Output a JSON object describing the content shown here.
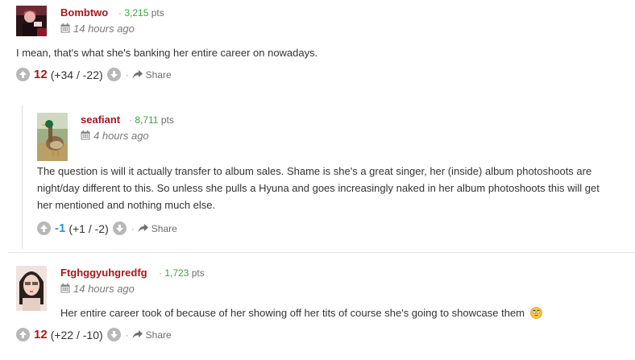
{
  "comments": [
    {
      "username": "Bombtwo",
      "points": "3,215",
      "points_suffix": "pts",
      "time": "14 hours ago",
      "text": "I mean, that's what she's banking her entire career on nowadays.",
      "score": "12",
      "breakdown": "(+34 / -22)",
      "share": "Share"
    },
    {
      "username": "seafiant",
      "points": "8,711",
      "points_suffix": "pts",
      "time": "4 hours ago",
      "text": "The question is will it actually transfer to album sales. Shame is she's a great singer, her (inside) album photoshoots are night/day different to this. So unless she pulls a Hyuna and goes increasingly naked in her album photoshoots this will get her mentioned and nothing much else.",
      "score": "-1",
      "breakdown": "(+1 / -2)",
      "share": "Share"
    },
    {
      "username": "Ftghggyuhgredfg",
      "points": "1,723",
      "points_suffix": "pts",
      "time": "14 hours ago",
      "text": "Her entire career took of because of her showing off her tits of course she's going to showcase them",
      "score": "12",
      "breakdown": "(+22 / -10)",
      "share": "Share"
    }
  ],
  "colors": {
    "username": "#a8171b",
    "points": "#3ba53b",
    "score_positive": "#b0161a",
    "score_negative": "#3a8fd6"
  },
  "icons": [
    "calendar-icon",
    "upvote-icon",
    "downvote-icon",
    "share-icon",
    "rolling-eyes-emoji"
  ]
}
